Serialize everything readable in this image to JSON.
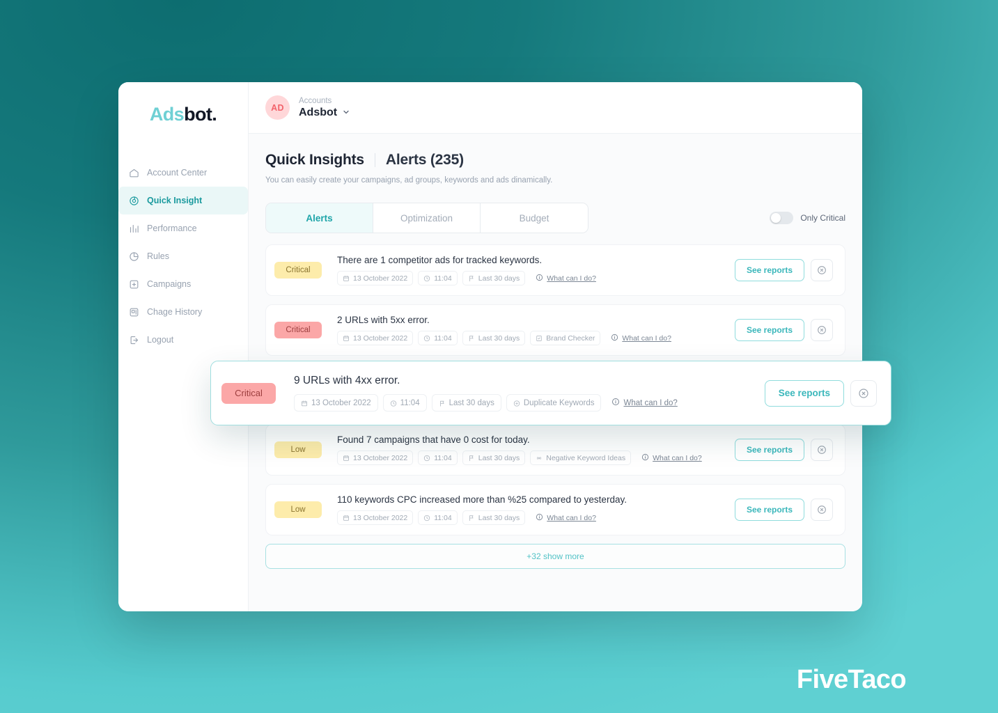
{
  "brand": {
    "logo_first": "Ads",
    "logo_second": "bot",
    "logo_dot": ".",
    "accent": "#3bb7bb",
    "logo_teal": "#6fd0d4",
    "logo_dark": "#121826"
  },
  "watermark": "FiveTaco",
  "sidebar": {
    "items": [
      {
        "label": "Account Center",
        "icon": "home-icon",
        "active": false
      },
      {
        "label": "Quick Insight",
        "icon": "insight-icon",
        "active": true
      },
      {
        "label": "Performance",
        "icon": "bar-chart-icon",
        "active": false
      },
      {
        "label": "Rules",
        "icon": "pie-chart-icon",
        "active": false
      },
      {
        "label": "Campaigns",
        "icon": "plus-square-icon",
        "active": false
      },
      {
        "label": "Chage History",
        "icon": "history-icon",
        "active": false
      },
      {
        "label": "Logout",
        "icon": "logout-icon",
        "active": false
      }
    ]
  },
  "topbar": {
    "avatar_initials": "AD",
    "account_label": "Accounts",
    "account_name": "Adsbot",
    "caret_icon": "chevron-down-icon"
  },
  "page": {
    "title": "Quick Insights",
    "subtitle": "Alerts (235)",
    "description": "You can easily create your campaigns, ad groups, keywords and ads dinamically."
  },
  "tabs": [
    {
      "label": "Alerts",
      "active": true
    },
    {
      "label": "Optimization",
      "active": false
    },
    {
      "label": "Budget",
      "active": false
    }
  ],
  "only_critical": {
    "label": "Only Critical",
    "enabled": false
  },
  "actions": {
    "see_reports": "See reports",
    "dismiss_icon": "close-circle-icon",
    "show_more": "+32 show more",
    "what_can_i_do": "What can I do?",
    "info_icon": "info-circle-icon"
  },
  "alerts": [
    {
      "severity": "Critical",
      "severity_color": "yellow",
      "title": "There are 1 competitor ads for tracked keywords.",
      "chips": [
        {
          "icon": "calendar-icon",
          "label": "13 October 2022"
        },
        {
          "icon": "clock-icon",
          "label": "11:04"
        },
        {
          "icon": "flag-icon",
          "label": "Last 30 days"
        }
      ]
    },
    {
      "severity": "Critical",
      "severity_color": "red",
      "title": "2 URLs with 5xx error.",
      "chips": [
        {
          "icon": "calendar-icon",
          "label": "13 October 2022"
        },
        {
          "icon": "clock-icon",
          "label": "11:04"
        },
        {
          "icon": "flag-icon",
          "label": "Last 30 days"
        },
        {
          "icon": "shield-check-icon",
          "label": "Brand Checker"
        }
      ]
    },
    {
      "severity": "Low",
      "severity_color": "yellow",
      "title": "Found 7 campaigns that have 0 cost for today.",
      "chips": [
        {
          "icon": "calendar-icon",
          "label": "13 October 2022"
        },
        {
          "icon": "clock-icon",
          "label": "11:04"
        },
        {
          "icon": "flag-icon",
          "label": "Last 30 days"
        },
        {
          "icon": "broadcast-icon",
          "label": "Negative Keyword Ideas"
        }
      ]
    },
    {
      "severity": "Low",
      "severity_color": "yellow",
      "title": "110 keywords CPC increased more than %25 compared to yesterday.",
      "chips": [
        {
          "icon": "calendar-icon",
          "label": "13 October 2022"
        },
        {
          "icon": "clock-icon",
          "label": "11:04"
        },
        {
          "icon": "flag-icon",
          "label": "Last 30 days"
        }
      ]
    }
  ],
  "floating_alert": {
    "severity": "Critical",
    "severity_color": "red",
    "title": "9 URLs with 4xx error.",
    "chips": [
      {
        "icon": "calendar-icon",
        "label": "13 October 2022"
      },
      {
        "icon": "clock-icon",
        "label": "11:04"
      },
      {
        "icon": "flag-icon",
        "label": "Last 30 days"
      },
      {
        "icon": "target-icon",
        "label": "Duplicate Keywords"
      }
    ]
  }
}
